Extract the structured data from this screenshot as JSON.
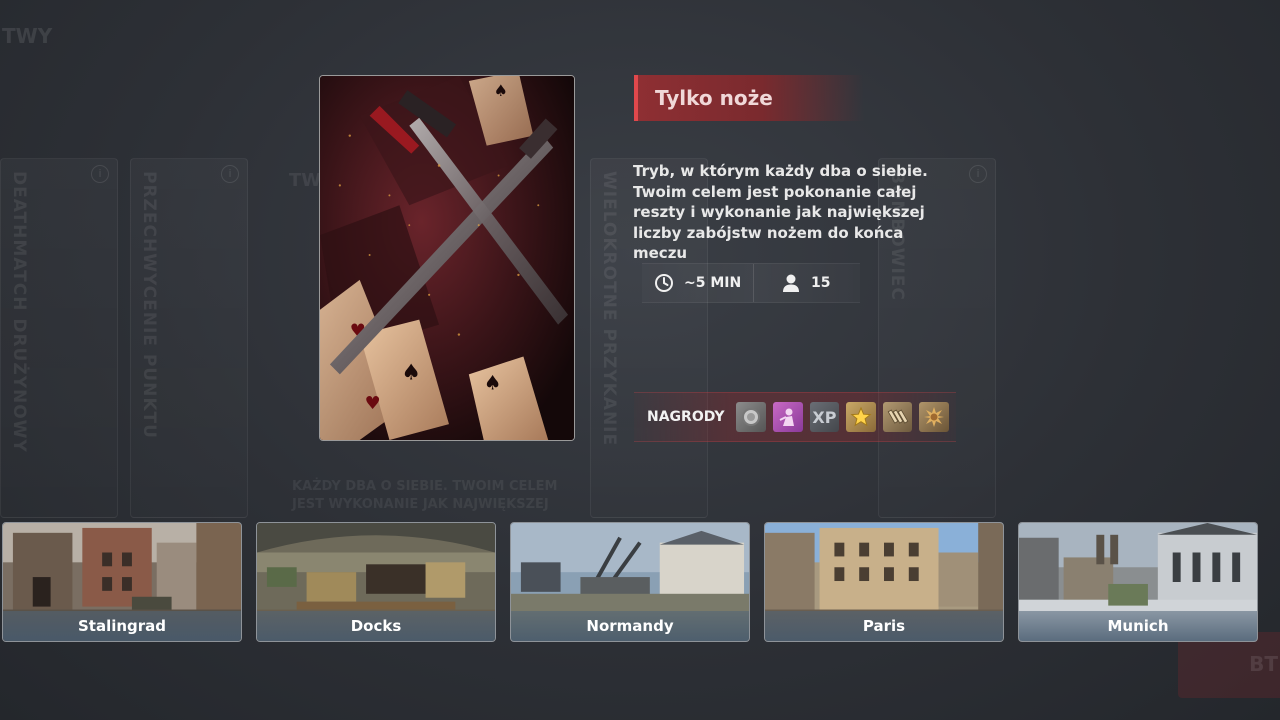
{
  "background": {
    "corner_label": "TWY",
    "card_labels": [
      "DEATHMATCH DRUŻYNOWY",
      "PRZECHWYCENIE PUNKTU",
      "WIELOKROTNE PRZYKANIE",
      "BOMBOWIEC"
    ],
    "mid_label": "TWY",
    "desc_lines": [
      "KAŻDY DBA O SIEBIE. TWOIM CELEM",
      "JEST WYKONANIE JAK NAJWIĘKSZEJ"
    ],
    "button_label": "BT"
  },
  "mode": {
    "title": "Tylko noże",
    "description": [
      "Tryb, w którym każdy dba o siebie.",
      "Twoim celem jest pokonanie całej",
      "reszty i wykonanie jak największej",
      "liczby zabójstw nożem do końca meczu"
    ],
    "duration": "~5 MIN",
    "players": "15",
    "time_icon": "clock-icon",
    "players_icon": "user-icon"
  },
  "rewards": {
    "label": "NAGRODY",
    "items": [
      {
        "name": "silver-coin-icon",
        "text": "",
        "color": "#8c8c8c"
      },
      {
        "name": "character-icon",
        "text": "",
        "color": "#c86ac4"
      },
      {
        "name": "xp-icon",
        "text": "XP",
        "color": "#6a6e75"
      },
      {
        "name": "star-icon",
        "text": "",
        "color": "#c9a867"
      },
      {
        "name": "ammo-icon",
        "text": "",
        "color": "#b29a72"
      },
      {
        "name": "medal-icon",
        "text": "",
        "color": "#b0956a"
      }
    ]
  },
  "maps": [
    {
      "name": "Stalingrad"
    },
    {
      "name": "Docks"
    },
    {
      "name": "Normandy"
    },
    {
      "name": "Paris"
    },
    {
      "name": "Munich"
    }
  ],
  "colors": {
    "accent_red": "#e0484c",
    "banner_red": "#8e2f33",
    "map_label_bg": "#465a6e"
  }
}
